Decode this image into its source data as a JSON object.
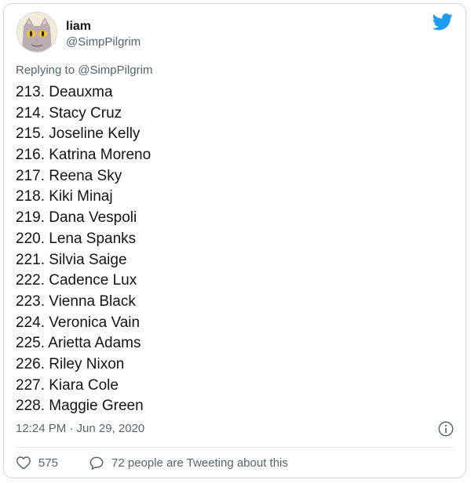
{
  "tweet": {
    "author": {
      "name": "liam",
      "handle": "@SimpPilgrim",
      "avatar_icon": "cat-avatar-icon"
    },
    "replying_to": "Replying to @SimpPilgrim",
    "items": [
      "213. Deauxma",
      "214. Stacy Cruz",
      "215. Joseline Kelly",
      "216. Katrina Moreno",
      "217. Reena Sky",
      "218. Kiki Minaj",
      "219. Dana Vespoli",
      "220. Lena Spanks",
      "221. Silvia Saige",
      "222. Cadence Lux",
      "223. Vienna Black",
      "224. Veronica Vain",
      "225. Arietta Adams",
      "226. Riley Nixon",
      "227. Kiara Cole",
      "228. Maggie Green"
    ],
    "timestamp": "12:24 PM · Jun 29, 2020",
    "likes": "575",
    "tweeting_about": "72 people are Tweeting about this"
  },
  "colors": {
    "brand": "#1d9bf0",
    "text": "#0f1419",
    "muted": "#536471",
    "border": "#cfd9de"
  },
  "icons": {
    "logo": "twitter-bird-icon",
    "info": "info-icon",
    "like": "heart-icon",
    "reply": "speech-bubble-icon"
  }
}
